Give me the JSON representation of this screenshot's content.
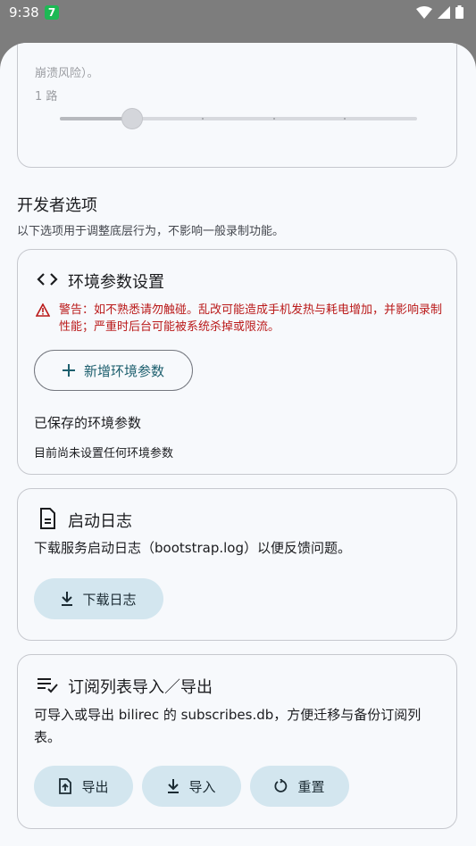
{
  "status": {
    "time": "9:38",
    "badge": "7"
  },
  "top_card": {
    "desc_tail": "崩溃风险）。",
    "value": "1 路",
    "slider_fraction": 0.2
  },
  "developer": {
    "title": "开发者选项",
    "subtitle": "以下选项用于调整底层行为，不影响一般录制功能。"
  },
  "env_card": {
    "title": "环境参数设置",
    "warning": "警告：如不熟悉请勿触碰。乱改可能造成手机发热与耗电增加，并影响录制性能；严重时后台可能被系统杀掉或限流。",
    "add_button": "新增环境参数",
    "saved_label": "已保存的环境参数",
    "empty_text": "目前尚未设置任何环境参数"
  },
  "log_card": {
    "title": "启动日志",
    "description": "下载服务启动日志（bootstrap.log）以便反馈问题。",
    "download_button": "下载日志"
  },
  "sub_card": {
    "title": "订阅列表导入／导出",
    "description": "可导入或导出 bilirec 的 subscribes.db，方便迁移与备份订阅列表。",
    "export_button": "导出",
    "import_button": "导入",
    "reset_button": "重置"
  },
  "colors": {
    "accent": "#1d5f6e",
    "warning": "#ba1a1a",
    "tonal": "#d3e6ef"
  }
}
